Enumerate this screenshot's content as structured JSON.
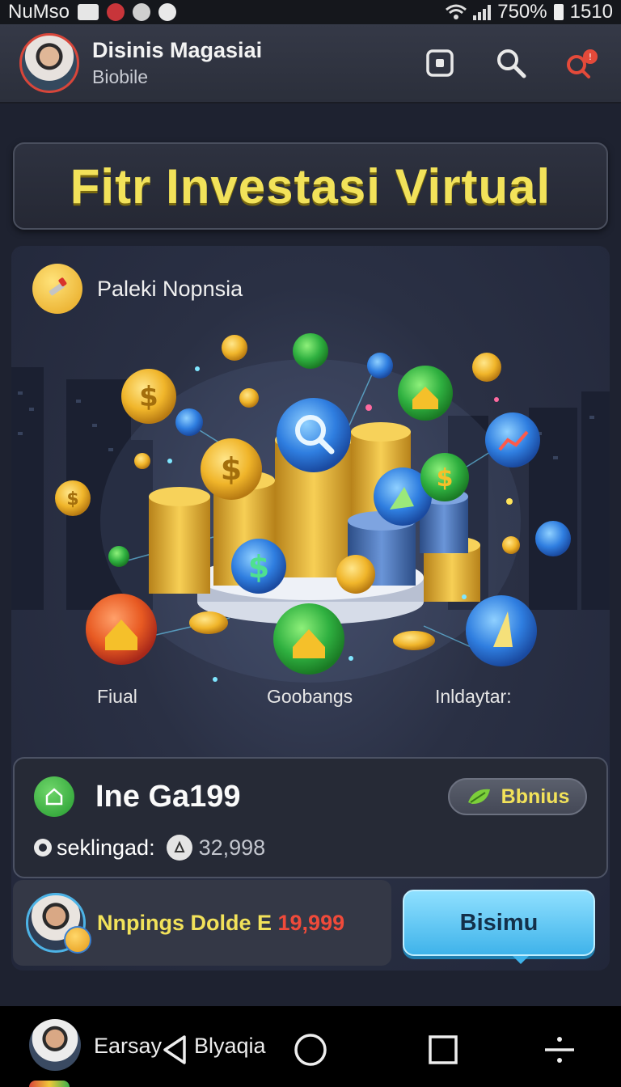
{
  "status_bar": {
    "carrier": "NuMso",
    "battery_text": "750%",
    "time": "1510"
  },
  "header": {
    "title": "Disinis Magasiai",
    "subtitle": "Biobile",
    "icons": [
      "square-icon",
      "search-icon",
      "alert-icon"
    ]
  },
  "banner": {
    "title": "Fitr Investasi Virtual"
  },
  "card": {
    "heading": "Paleki Nopnsia",
    "categories": [
      "Fiual",
      "Goobangs",
      "Inldaytar:"
    ]
  },
  "balance": {
    "title": "Ine Ga199",
    "bonus_label": "Bbnius",
    "row_label": "seklingad:",
    "row_value": "32,998"
  },
  "earn": {
    "label": "Nnpings Dolde E",
    "amount": "19,999"
  },
  "cta": {
    "label": "Bisimu"
  },
  "nav": {
    "left_label": "Earsay",
    "right_label": "Blyaqia"
  },
  "colors": {
    "accent_yellow": "#f2e25a",
    "accent_red": "#f04a3a",
    "cta_blue": "#3fb3ea",
    "background": "#1e2230"
  }
}
